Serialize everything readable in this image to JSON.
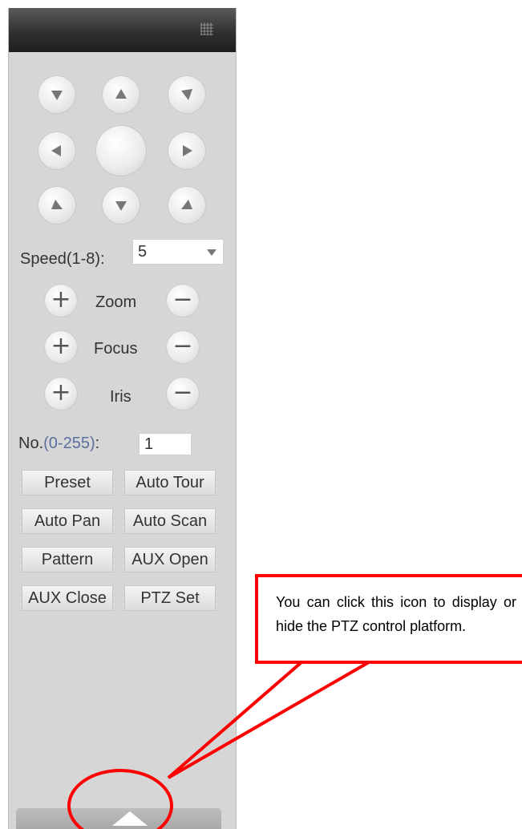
{
  "ptz_panel": {
    "speed": {
      "label": "Speed(1-8):",
      "value": "5"
    },
    "zoom_label": "Zoom",
    "focus_label": "Focus",
    "iris_label": "Iris",
    "number": {
      "label_prefix": "No.",
      "label_range": "(0-255)",
      "label_suffix": ":",
      "value": "1"
    },
    "buttons": {
      "preset": "Preset",
      "auto_tour": "Auto Tour",
      "auto_pan": "Auto Pan",
      "auto_scan": "Auto Scan",
      "pattern": "Pattern",
      "aux_open": "AUX Open",
      "aux_close": "AUX Close",
      "ptz_set": "PTZ Set"
    },
    "icons": {
      "plus": "+",
      "minus": "−"
    }
  },
  "callout": {
    "text": "You can click this icon to display or hide the PTZ control platform.",
    "color": "#ff0000"
  }
}
